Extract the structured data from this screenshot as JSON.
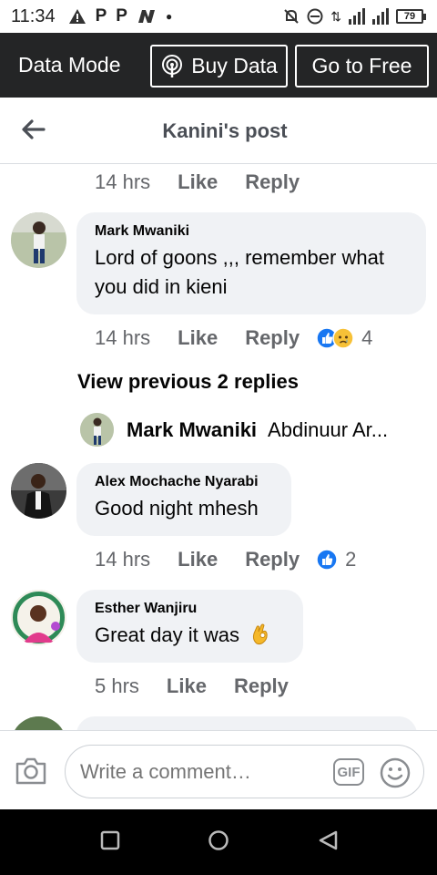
{
  "status_bar": {
    "time": "11:34",
    "battery": "79",
    "left_icons": [
      "P",
      "P"
    ]
  },
  "data_bar": {
    "mode_label": "Data Mode",
    "buy_label": "Buy Data",
    "free_label": "Go to Free"
  },
  "header": {
    "title": "Kanini's post"
  },
  "comments": [
    {
      "time": "14 hrs",
      "like": "Like",
      "reply": "Reply"
    },
    {
      "name": "Mark Mwaniki",
      "text": "Lord of goons ,,, remember what you did in kieni",
      "time": "14 hrs",
      "like": "Like",
      "reply": "Reply",
      "reaction_count": "4",
      "reactions": [
        "like-reaction-icon",
        "sad-reaction-icon"
      ]
    },
    {
      "name": "Alex Mochache Nyarabi",
      "text": "Good night mhesh",
      "time": "14 hrs",
      "like": "Like",
      "reply": "Reply",
      "reaction_count": "2",
      "reactions": [
        "like-reaction-icon"
      ]
    },
    {
      "name": "Esther Wanjiru",
      "text": "Great day it was",
      "emoji": "ok-hand-emoji",
      "time": "5 hrs",
      "like": "Like",
      "reply": "Reply"
    }
  ],
  "view_previous": "View previous 2 replies",
  "reply_preview": {
    "name": "Mark Mwaniki",
    "snippet": "Abdinuur Ar..."
  },
  "composer": {
    "placeholder": "Write a comment…"
  },
  "colors": {
    "dark_bar": "#242526",
    "like_blue": "#1877f2",
    "meta_gray": "#65676b",
    "bubble": "#f0f2f5"
  }
}
